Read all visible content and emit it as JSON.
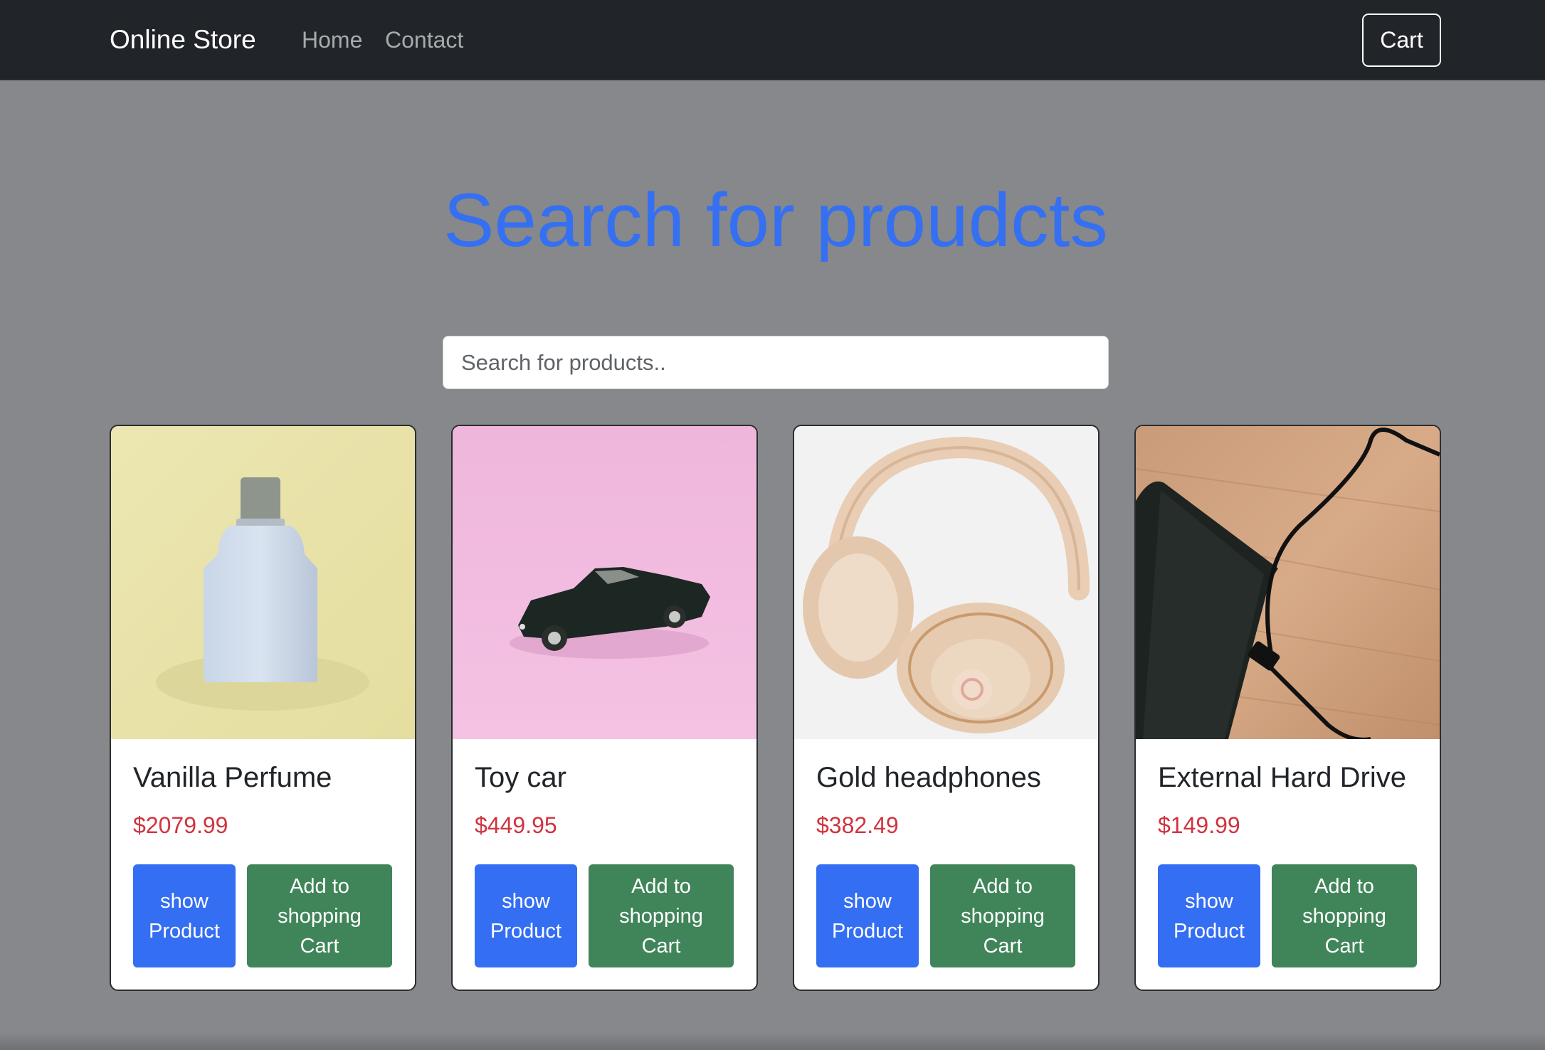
{
  "navbar": {
    "brand": "Online Store",
    "links": [
      {
        "label": "Home"
      },
      {
        "label": "Contact"
      }
    ],
    "cart_label": "Cart"
  },
  "hero": {
    "title": "Search for proudcts"
  },
  "search": {
    "placeholder": "Search for products..",
    "value": ""
  },
  "colors": {
    "navbar_bg": "#212529",
    "page_bg": "#87888b",
    "title_blue": "#3570f2",
    "price_red": "#d0343f",
    "show_button": "#346ef3",
    "add_button": "#40855a"
  },
  "products": [
    {
      "name": "Vanilla Perfume",
      "price": "$2079.99",
      "image": "perfume-bottle-photo",
      "show_label": "show Product",
      "add_label": "Add to shopping Cart"
    },
    {
      "name": "Toy car",
      "price": "$449.95",
      "image": "toy-car-photo",
      "show_label": "show Product",
      "add_label": "Add to shopping Cart"
    },
    {
      "name": "Gold headphones",
      "price": "$382.49",
      "image": "headphones-photo",
      "show_label": "show Product",
      "add_label": "Add to shopping Cart"
    },
    {
      "name": "External Hard Drive",
      "price": "$149.99",
      "image": "hard-drive-photo",
      "show_label": "show Product",
      "add_label": "Add to shopping Cart"
    }
  ]
}
